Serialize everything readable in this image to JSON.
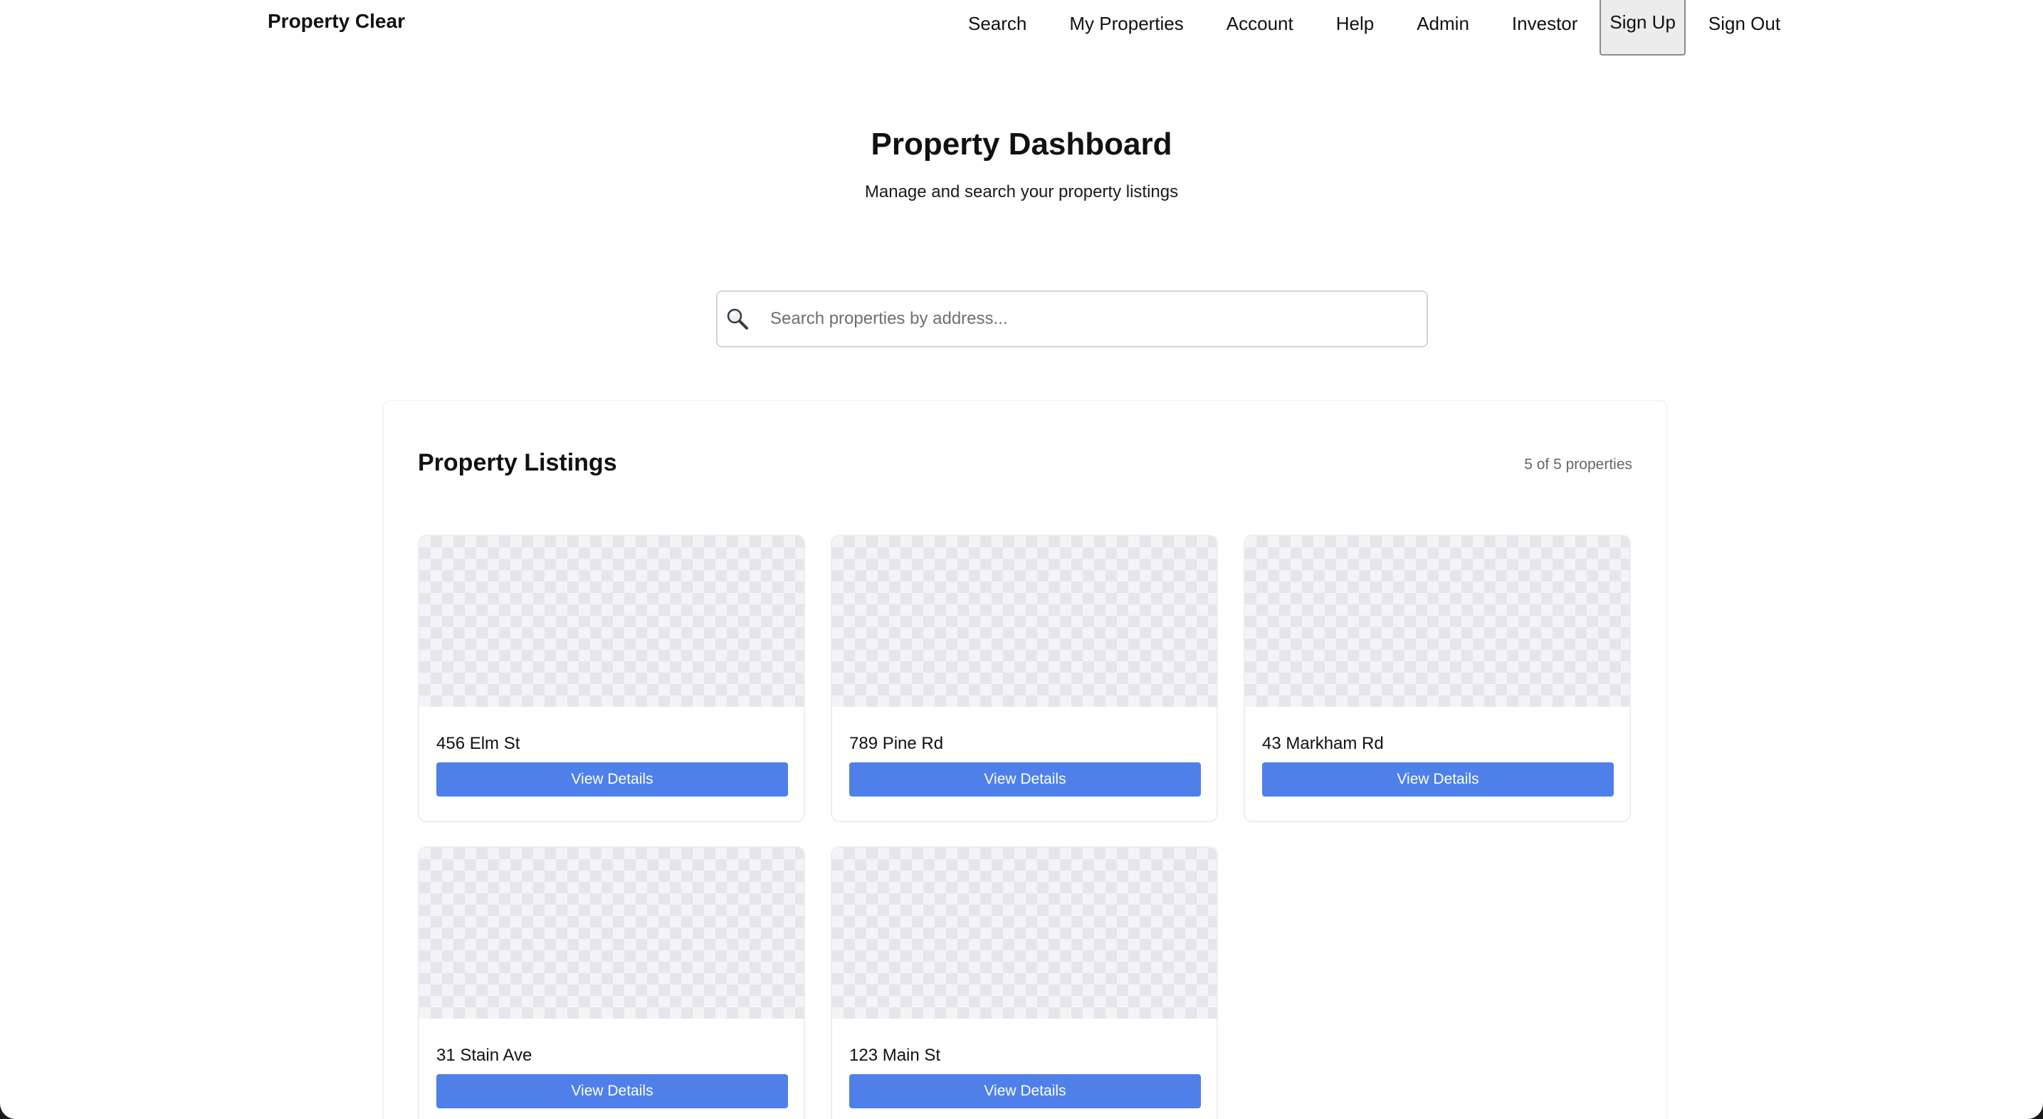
{
  "nav": {
    "brand": "Property Clear",
    "links": [
      {
        "label": "Search"
      },
      {
        "label": "My Properties"
      },
      {
        "label": "Account"
      },
      {
        "label": "Help"
      },
      {
        "label": "Admin"
      },
      {
        "label": "Investor"
      },
      {
        "label": "Sign Up"
      },
      {
        "label": "Sign Out"
      }
    ]
  },
  "header": {
    "title": "Property Dashboard",
    "subtitle": "Manage and search your property listings"
  },
  "search": {
    "icon": "magnifier-icon",
    "placeholder": "Search properties by address...",
    "value": ""
  },
  "listings": {
    "title": "Property Listings",
    "count_text": "5 of 5 properties",
    "button_label": "View Details",
    "items": [
      {
        "address": "456 Elm St",
        "button": "View Details"
      },
      {
        "address": "789 Pine Rd",
        "button": "View Details"
      },
      {
        "address": "43 Markham Rd",
        "button": "View Details"
      },
      {
        "address": "31 Stain Ave",
        "button": "View Details"
      },
      {
        "address": "123 Main St",
        "button": "View Details"
      }
    ]
  },
  "colors": {
    "accent": "#4f80ea",
    "text": "#111111",
    "muted": "#666666"
  }
}
